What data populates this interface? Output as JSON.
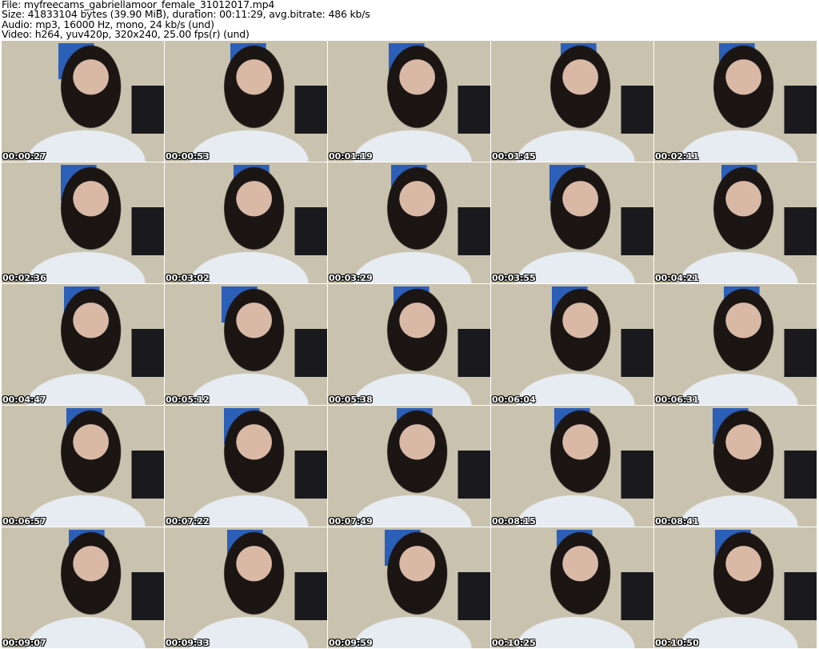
{
  "header": {
    "file": "File: myfreecams_gabriellamoor_female_31012017.mp4",
    "size": "Size: 41833104 bytes (39.90 MiB), duration: 00:11:29, avg.bitrate: 486 kb/s",
    "audio": "Audio: mp3, 16000 Hz, mono, 24 kb/s (und)",
    "video": "Video: h264, yuv420p, 320x240, 25.00 fps(r) (und)"
  },
  "thumbnails": [
    "00:00:27",
    "00:00:53",
    "00:01:19",
    "00:01:45",
    "00:02:11",
    "00:02:36",
    "00:03:02",
    "00:03:29",
    "00:03:55",
    "00:04:21",
    "00:04:47",
    "00:05:12",
    "00:05:38",
    "00:06:04",
    "00:06:31",
    "00:06:57",
    "00:07:22",
    "00:07:49",
    "00:08:15",
    "00:08:41",
    "00:09:07",
    "00:09:33",
    "00:09:59",
    "00:10:25",
    "00:10:50"
  ]
}
